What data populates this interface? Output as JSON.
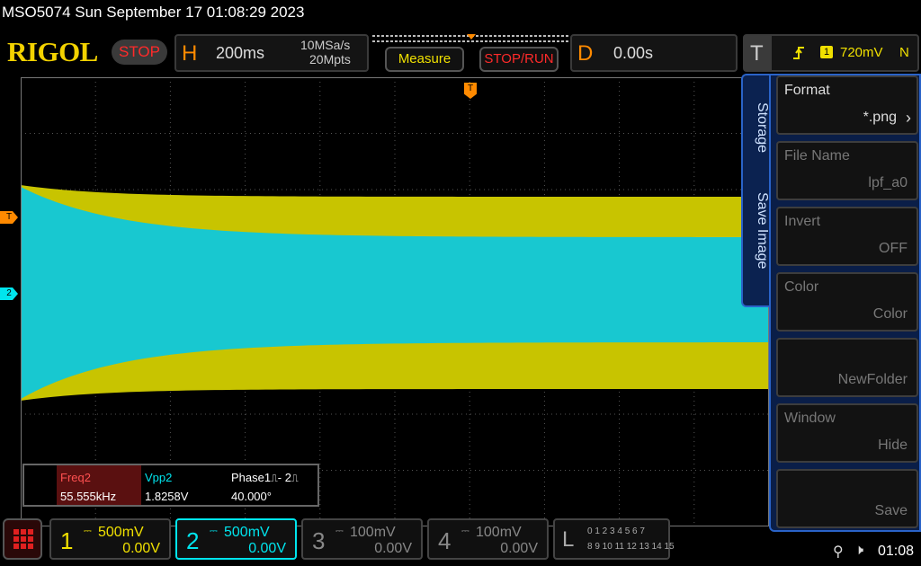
{
  "header": {
    "title": "MSO5074  Sun September 17 01:08:29 2023",
    "logo": "RIGOL",
    "run_state": "STOP",
    "horizontal": {
      "letter": "H",
      "timebase": "200ms",
      "sample_rate": "10MSa/s",
      "memory_depth": "20Mpts"
    },
    "measure_label": "Measure",
    "stop_run_label": "STOP/RUN",
    "delay": {
      "letter": "D",
      "value": "0.00s"
    },
    "trigger": {
      "letter": "T",
      "source": "1",
      "level": "720mV",
      "mode": "N"
    }
  },
  "markers": {
    "trigger_level": "T",
    "channel2": "2",
    "trigger_pos": "T"
  },
  "measurements": {
    "freq_label": "Freq2",
    "freq_value": "55.555kHz",
    "vpp_label": "Vpp2",
    "vpp_value": "1.8258V",
    "phase_label": "Phase1",
    "phase_suffix": "- 2",
    "phase_value": "40.000°"
  },
  "side_tabs": {
    "storage": "Storage",
    "save_image": "Save Image"
  },
  "menu": [
    {
      "label": "Format",
      "value": "*.png",
      "dim": false
    },
    {
      "label": "File Name",
      "value": "lpf_a0",
      "dim": true
    },
    {
      "label": "Invert",
      "value": "OFF",
      "dim": true
    },
    {
      "label": "Color",
      "value": "Color",
      "dim": true
    },
    {
      "label": "",
      "value": "NewFolder",
      "dim": true
    },
    {
      "label": "Window",
      "value": "Hide",
      "dim": true
    },
    {
      "label": "",
      "value": "Save",
      "dim": true
    }
  ],
  "channels": [
    {
      "num": "1",
      "scale": "500mV",
      "offset": "0.00V",
      "color": "#f0e000"
    },
    {
      "num": "2",
      "scale": "500mV",
      "offset": "0.00V",
      "color": "#00e5ee"
    },
    {
      "num": "3",
      "scale": "100mV",
      "offset": "0.00V",
      "color": "#888888"
    },
    {
      "num": "4",
      "scale": "100mV",
      "offset": "0.00V",
      "color": "#888888"
    }
  ],
  "logic": {
    "letter": "L",
    "row1": "0 1 2 3  4 5 6 7",
    "row2": "8 9 10 11 12 13 14 15"
  },
  "status": {
    "time": "01:08"
  },
  "colors": {
    "ch1": "#c8c400",
    "ch2": "#18c8d0",
    "accent": "#ff8a00"
  }
}
